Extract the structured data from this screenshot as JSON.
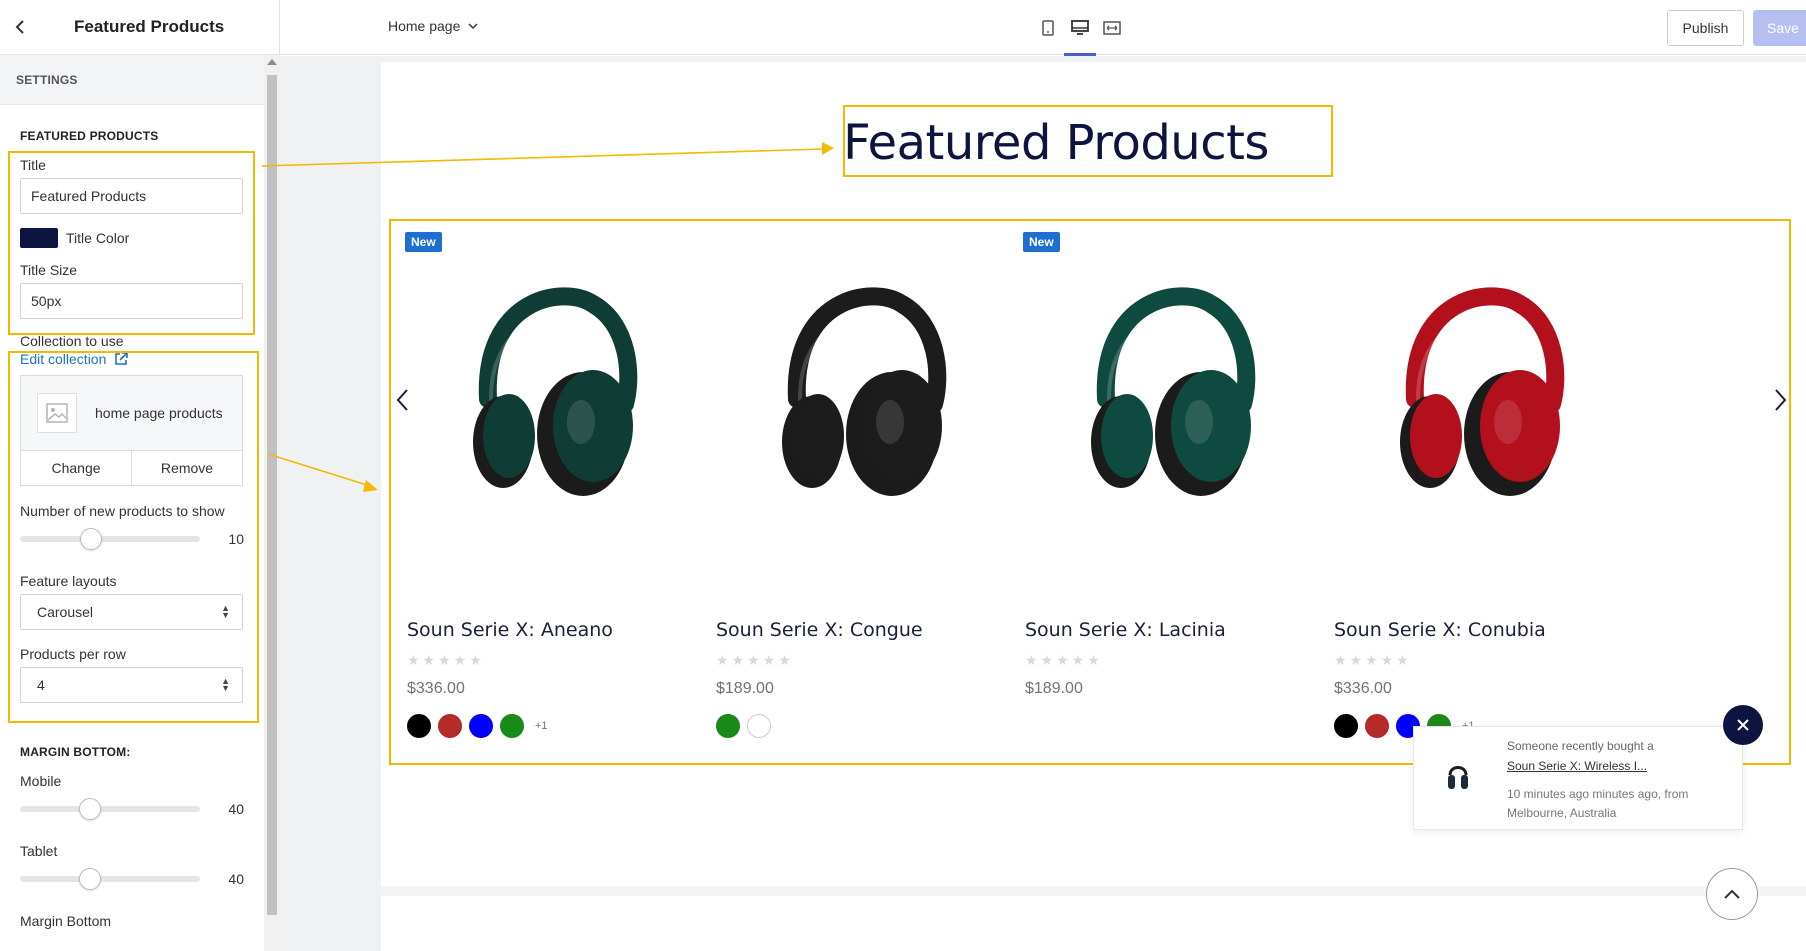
{
  "sidebar": {
    "title": "Featured Products",
    "settings_label": "SETTINGS",
    "section_featured": "FEATURED PRODUCTS",
    "title_label": "Title",
    "title_value": "Featured Products",
    "title_color_label": "Title Color",
    "title_color": "#0d1440",
    "title_size_label": "Title Size",
    "title_size_value": "50px",
    "collection_label": "Collection to use",
    "edit_collection": "Edit collection",
    "collection_name": "home page products",
    "change_label": "Change",
    "remove_label": "Remove",
    "new_products_label": "Number of new products to show",
    "new_products_value": "10",
    "layouts_label": "Feature layouts",
    "layout_value": "Carousel",
    "per_row_label": "Products per row",
    "per_row_value": "4",
    "margin_section": "MARGIN BOTTOM:",
    "mobile_label": "Mobile",
    "mobile_value": "40",
    "tablet_label": "Tablet",
    "tablet_value": "40",
    "margin_bottom_label": "Margin Bottom"
  },
  "topbar": {
    "page_select": "Home page",
    "publish": "Publish",
    "save": "Save",
    "device_icons": [
      "mobile-icon",
      "desktop-icon",
      "fullwidth-icon"
    ],
    "active_device": "desktop-icon"
  },
  "preview": {
    "heading": "Featured Products",
    "badge_label": "New",
    "products": [
      {
        "name": "Soun Serie X: Aneano",
        "price": "$336.00",
        "stars": "★★★★★",
        "badge": true,
        "color": "#0f3d35",
        "swatches": [
          "#000000",
          "#b52a2a",
          "#0000ff",
          "#1a8a1a"
        ],
        "more": "+1"
      },
      {
        "name": "Soun Serie X: Congue",
        "price": "$189.00",
        "stars": "★★★★★",
        "badge": false,
        "color": "#1c1c1c",
        "swatches": [
          "#1a8a1a",
          "#ffffff"
        ],
        "more": ""
      },
      {
        "name": "Soun Serie X: Lacinia",
        "price": "$189.00",
        "stars": "★★★★★",
        "badge": true,
        "color": "#0f4a40",
        "swatches": [],
        "more": ""
      },
      {
        "name": "Soun Serie X: Conubia",
        "price": "$336.00",
        "stars": "★★★★★",
        "badge": false,
        "color": "#b3101e",
        "swatches": [
          "#000000",
          "#b52a2a",
          "#0000ff",
          "#1a8a1a"
        ],
        "more": "+1"
      }
    ]
  },
  "toast": {
    "line1": "Someone recently bought a",
    "line2": "Soun Serie X: Wireless I...",
    "line3": "10 minutes ago minutes ago, from Melbourne, Australia"
  },
  "colors": {
    "highlight": "#f5b800",
    "accent": "#4b5cc4",
    "badge": "#1e6fd1"
  }
}
